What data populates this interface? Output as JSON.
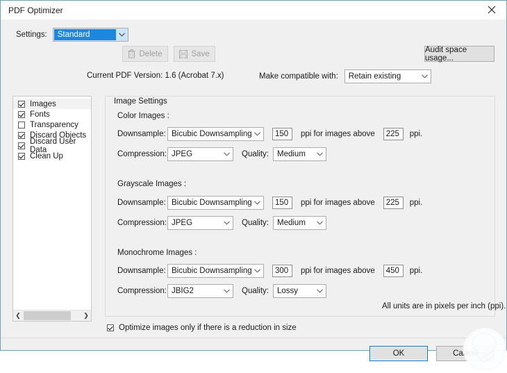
{
  "window": {
    "title": "PDF Optimizer",
    "close_icon": "close-icon",
    "accent_blue": "#1a88e0",
    "border_color": "#6fa0b8"
  },
  "toolbar": {
    "settings_label": "Settings:",
    "settings_value": "Standard",
    "delete_label": "Delete",
    "delete_icon": "trash-icon",
    "save_label": "Save",
    "save_icon": "floppy-disk-icon",
    "audit_label": "Audit space usage...",
    "pdf_version": "Current PDF Version: 1.6 (Acrobat 7.x)",
    "compat_label": "Make compatible with:",
    "compat_value": "Retain existing"
  },
  "sidebar": {
    "items": [
      {
        "label": "Images",
        "checked": true,
        "selected": true
      },
      {
        "label": "Fonts",
        "checked": true,
        "selected": false
      },
      {
        "label": "Transparency",
        "checked": false,
        "selected": false
      },
      {
        "label": "Discard Objects",
        "checked": true,
        "selected": false
      },
      {
        "label": "Discard User Data",
        "checked": true,
        "selected": false
      },
      {
        "label": "Clean Up",
        "checked": true,
        "selected": false
      }
    ],
    "scroll_left_icon": "chevron-left-icon",
    "scroll_right_icon": "chevron-right-icon"
  },
  "main": {
    "group_title": "Image Settings",
    "labels": {
      "downsample": "Downsample:",
      "compression": "Compression:",
      "quality": "Quality:",
      "ppi_mid": "ppi for images above",
      "ppi_end": "ppi."
    },
    "sections": [
      {
        "title": "Color Images :",
        "downsample_method": "Bicubic Downsampling to",
        "downsample_ppi": "150",
        "threshold_ppi": "225",
        "compression": "JPEG",
        "quality": "Medium"
      },
      {
        "title": "Grayscale Images :",
        "downsample_method": "Bicubic Downsampling to",
        "downsample_ppi": "150",
        "threshold_ppi": "225",
        "compression": "JPEG",
        "quality": "Medium"
      },
      {
        "title": "Monochrome Images :",
        "downsample_method": "Bicubic Downsampling to",
        "downsample_ppi": "300",
        "threshold_ppi": "450",
        "compression": "JBIG2",
        "quality": "Lossy"
      }
    ],
    "units_note": "All units are in pixels per inch (ppi)."
  },
  "footer": {
    "optimize_checkbox_label": "Optimize images only if there is a reduction in size",
    "optimize_checked": true,
    "ok_label": "OK",
    "cancel_label": "Cancel"
  }
}
